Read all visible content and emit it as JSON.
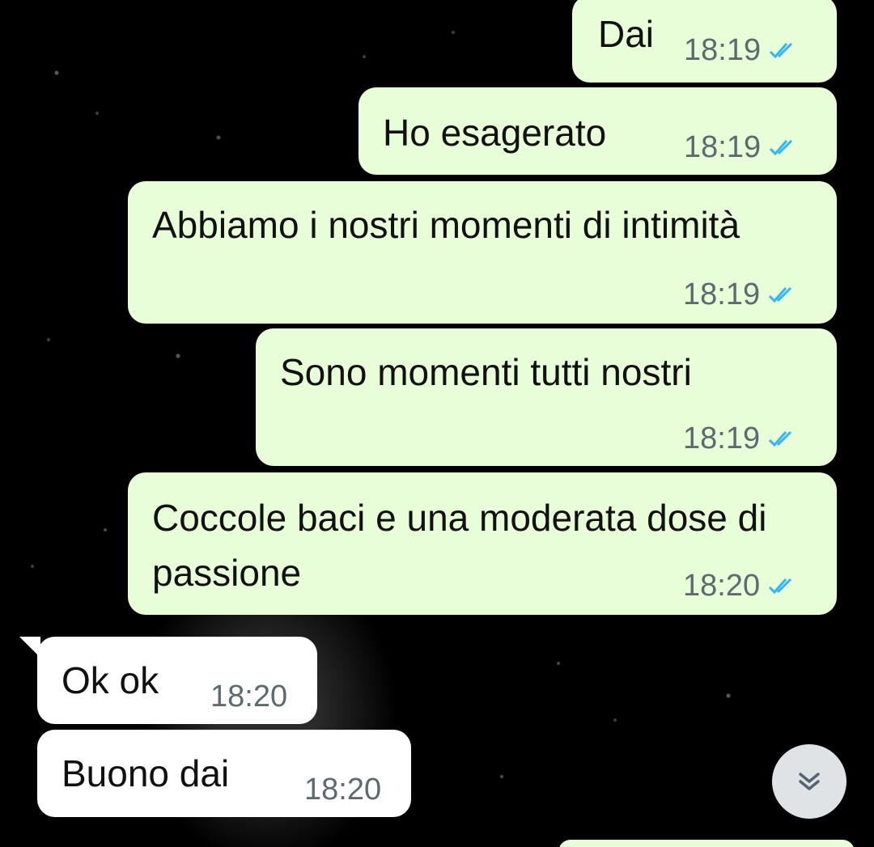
{
  "colors": {
    "outgoing_bubble": "#e7fed9",
    "incoming_bubble": "#ffffff",
    "read_tick": "#34b7f1",
    "background": "#000000"
  },
  "messages": [
    {
      "direction": "outgoing",
      "text": "Dai",
      "time": "18:19",
      "status": "read"
    },
    {
      "direction": "outgoing",
      "text": "Ho esagerato",
      "time": "18:19",
      "status": "read"
    },
    {
      "direction": "outgoing",
      "text": "Abbiamo i nostri momenti di intimità",
      "time": "18:19",
      "status": "read"
    },
    {
      "direction": "outgoing",
      "text": "Sono momenti tutti nostri",
      "time": "18:19",
      "status": "read"
    },
    {
      "direction": "outgoing",
      "text": "Coccole baci e una moderata dose di passione",
      "time": "18:20",
      "status": "read"
    },
    {
      "direction": "incoming",
      "text": "Ok ok",
      "time": "18:20"
    },
    {
      "direction": "incoming",
      "text": "Buono dai",
      "time": "18:20"
    }
  ],
  "scroll_button": {
    "icon": "double-chevron-down-icon"
  }
}
